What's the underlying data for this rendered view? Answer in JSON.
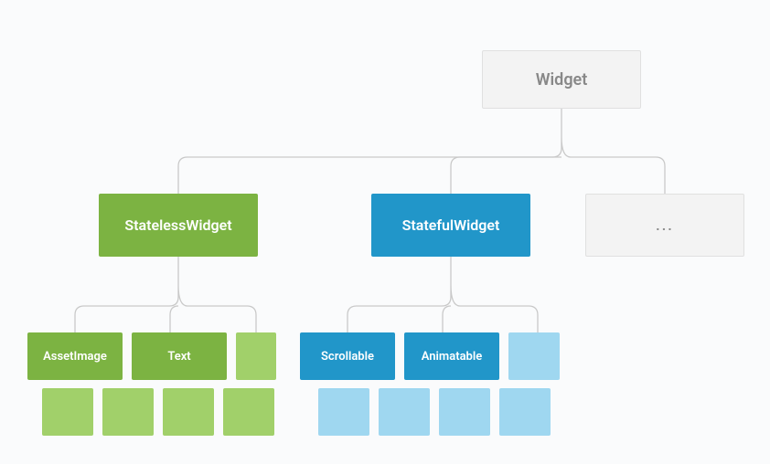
{
  "tree": {
    "root": {
      "label": "Widget"
    },
    "stateless": {
      "label": "StatelessWidget",
      "leaves": [
        "AssetImage",
        "Text"
      ]
    },
    "stateful": {
      "label": "StatefulWidget",
      "leaves": [
        "Scrollable",
        "Animatable"
      ]
    },
    "more": {
      "label": "..."
    }
  },
  "colors": {
    "root_bg": "#f3f3f3",
    "root_border": "#e0e0e0",
    "root_text": "#888888",
    "green": "#7cb342",
    "green_light": "#a1d06a",
    "blue": "#2196c9",
    "blue_light": "#9fd7f0",
    "line": "#c9c9c9"
  }
}
